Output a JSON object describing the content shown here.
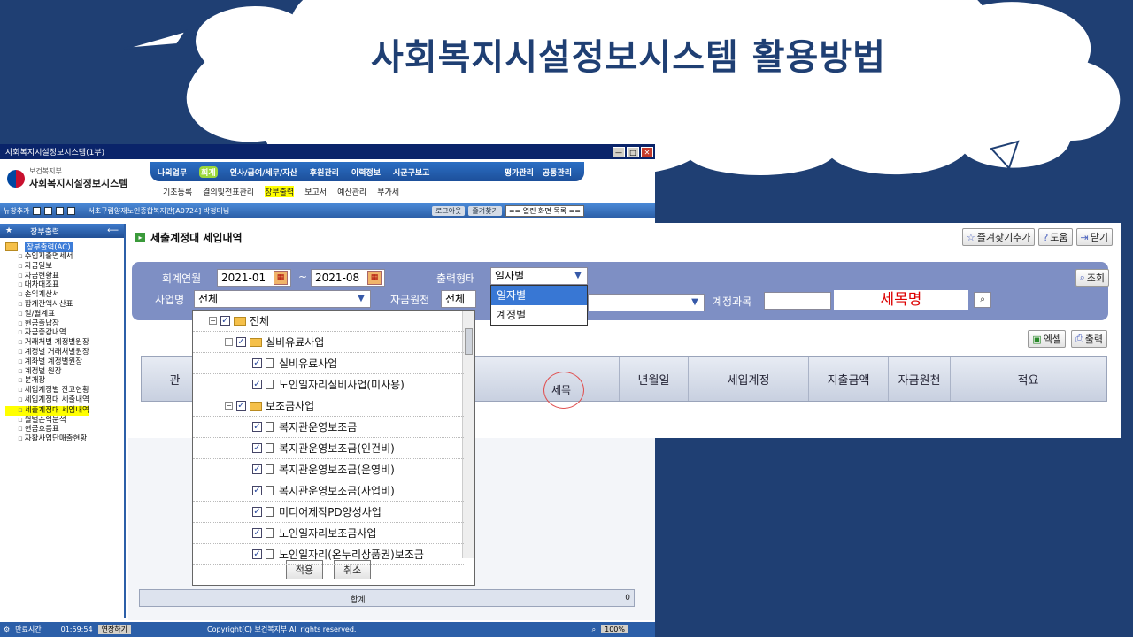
{
  "slide": {
    "title": "사회복지시설정보시스템 활용방법"
  },
  "window": {
    "title": "사회복지시설정보시스템(1부)",
    "min": "—",
    "max": "□",
    "close": "✕"
  },
  "logo": {
    "line1": "보건복지부",
    "line2": "사회복지시설정보시스템"
  },
  "menu": {
    "items": [
      "나의업무",
      "회계",
      "인사/급여/세무/자산",
      "후원관리",
      "이력정보",
      "시군구보고"
    ],
    "right": [
      "평가관리",
      "공통관리"
    ]
  },
  "submenu": [
    "기초등록",
    "결의및전표관리",
    "장부출력",
    "보고서",
    "예산관리",
    "부가세"
  ],
  "toolbar": {
    "label": "뉴창추가",
    "user": "서초구립양재노인종합복지관[A0724] 박정미님",
    "logout": "로그아웃",
    "fav": "즐겨찾기",
    "open": "== 열린 화면 목록 =="
  },
  "sidebar": {
    "header": "장부출력",
    "pin": "⟵",
    "root": "장부출력(AC)",
    "items": [
      "수입지출명세서",
      "자금일보",
      "자금현황표",
      "대차대조표",
      "손익계산서",
      "합계잔액시산표",
      "일/월계표",
      "현금출납장",
      "자금증감내역",
      "거래처별 계정별원장",
      "계정별 거래처별원장",
      "계좌별 계정별원장",
      "계정별 원장",
      "분개장",
      "세입계정별 잔고현황",
      "세입계정대 세출내역",
      "세출계정대 세입내역",
      "월별손익분석",
      "현금흐름표",
      "자활사업단매출현황"
    ],
    "highlight_index": 16
  },
  "status": {
    "time_label": "만료시간",
    "time": "01:59:54",
    "extend": "연장하기",
    "copyright": "Copyright(C) 보건복지부 All rights reserved.",
    "zoom": "100%"
  },
  "panel": {
    "title": "세출계정대 세입내역",
    "fav_btn": "즐겨찾기추가",
    "help_btn": "도움",
    "close_btn": "닫기",
    "labels": {
      "period": "회계연월",
      "tilde": "~",
      "output": "출력형태",
      "project": "사업명",
      "fund": "자금원천",
      "account": "계정과목"
    },
    "values": {
      "from": "2021-01",
      "to": "2021-08",
      "output": "일자별",
      "project": "전체",
      "fund": "전체",
      "semok": "세목명"
    },
    "dropdown_options": [
      "일자별",
      "계정별"
    ],
    "search_btn": "조회",
    "excel_btn": "엑셀",
    "print_btn": "출력",
    "columns": [
      "관",
      "세목",
      "년월일",
      "세입계정",
      "지출금액",
      "자금원천",
      "적요"
    ],
    "sum_label": "합계",
    "sum_value": "0"
  },
  "tree_popup": {
    "rows": [
      {
        "label": "전체",
        "level": 0,
        "folder": true
      },
      {
        "label": "실비유료사업",
        "level": 1,
        "folder": true
      },
      {
        "label": "실비유료사업",
        "level": 2,
        "folder": false
      },
      {
        "label": "노인일자리실비사업(미사용)",
        "level": 2,
        "folder": false
      },
      {
        "label": "보조금사업",
        "level": 1,
        "folder": true
      },
      {
        "label": "복지관운영보조금",
        "level": 2,
        "folder": false
      },
      {
        "label": "복지관운영보조금(인건비)",
        "level": 2,
        "folder": false
      },
      {
        "label": "복지관운영보조금(운영비)",
        "level": 2,
        "folder": false
      },
      {
        "label": "복지관운영보조금(사업비)",
        "level": 2,
        "folder": false
      },
      {
        "label": "미디어제작PD양성사업",
        "level": 2,
        "folder": false
      },
      {
        "label": "노인일자리보조금사업",
        "level": 2,
        "folder": false
      },
      {
        "label": "노인일자리(온누리상품권)보조금",
        "level": 2,
        "folder": false
      }
    ],
    "apply": "적용",
    "cancel": "취소"
  },
  "colors": {
    "slide_bg": "#1f3f73",
    "menu_blue": "#2b6fc4",
    "search_bg": "#7e8fc4",
    "highlight": "#ffff00"
  }
}
